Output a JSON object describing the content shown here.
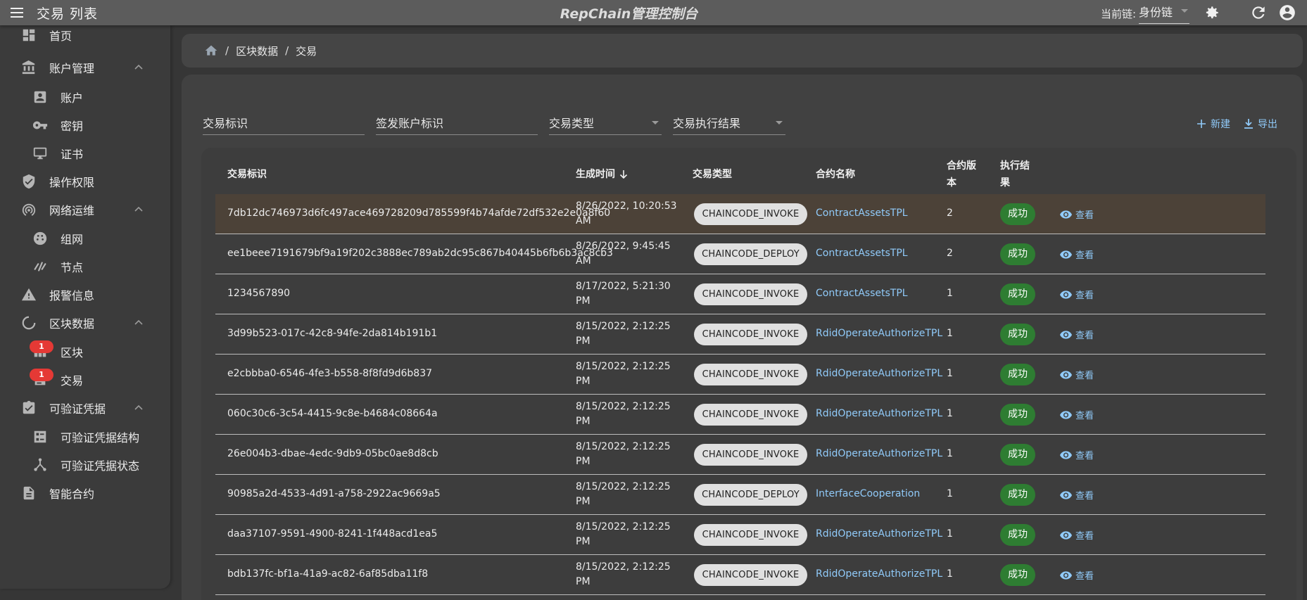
{
  "appbar": {
    "page_title": "交易 列表",
    "brand": "RepChain管理控制台",
    "chain_label": "当前链:",
    "chain_value": "身份链"
  },
  "sidebar": {
    "items": [
      {
        "label": "首页",
        "icon": "dashboard-icon"
      },
      {
        "label": "账户管理",
        "icon": "bank-icon",
        "expanded": true
      },
      {
        "label": "账户",
        "icon": "account-box-icon"
      },
      {
        "label": "密钥",
        "icon": "key-icon"
      },
      {
        "label": "证书",
        "icon": "certificate-icon"
      },
      {
        "label": "操作权限",
        "icon": "shield-icon"
      },
      {
        "label": "网络运维",
        "icon": "access-point-icon",
        "expanded": true
      },
      {
        "label": "组网",
        "icon": "network-icon"
      },
      {
        "label": "节点",
        "icon": "node-icon"
      },
      {
        "label": "报警信息",
        "icon": "alert-icon"
      },
      {
        "label": "区块数据",
        "icon": "block-data-icon",
        "expanded": true
      },
      {
        "label": "区块",
        "icon": "blocks-icon",
        "badge": "1"
      },
      {
        "label": "交易",
        "icon": "transaction-icon",
        "badge": "1"
      },
      {
        "label": "可验证凭据",
        "icon": "clipboard-check-icon",
        "expanded": true
      },
      {
        "label": "可验证凭据结构",
        "icon": "credential-schema-icon"
      },
      {
        "label": "可验证凭据状态",
        "icon": "credential-status-icon"
      },
      {
        "label": "智能合约",
        "icon": "contract-file-icon"
      }
    ]
  },
  "breadcrumb": {
    "items": [
      "区块数据",
      "交易"
    ],
    "separator": "/"
  },
  "filters": {
    "tx_id": "交易标识",
    "signer_id": "签发账户标识",
    "tx_type": "交易类型",
    "tx_result": "交易执行结果"
  },
  "actions": {
    "new": "新建",
    "export": "导出"
  },
  "table": {
    "headers": {
      "tx_id": "交易标识",
      "time": "生成时间",
      "type": "交易类型",
      "contract": "合约名称",
      "version_1": "合约版",
      "version_2": "本",
      "result_1": "执行结",
      "result_2": "果"
    },
    "view_label": "查看",
    "rows": [
      {
        "id": "7db12dc746973d6fc497ace469728209d785599f4b74afde72df532e2e0a8f60",
        "time1": "8/26/2022, 10:20:53",
        "time2": "AM",
        "type": "CHAINCODE_INVOKE",
        "contract": "ContractAssetsTPL",
        "version": "2",
        "result": "成功"
      },
      {
        "id": "ee1beee7191679bf9a19f202c3888ec789ab2dc95c867b40445b6fb6b3ac8cb3",
        "time1": "8/26/2022, 9:45:45",
        "time2": "AM",
        "type": "CHAINCODE_DEPLOY",
        "contract": "ContractAssetsTPL",
        "version": "2",
        "result": "成功"
      },
      {
        "id": "1234567890",
        "time1": "8/17/2022, 5:21:30",
        "time2": "PM",
        "type": "CHAINCODE_INVOKE",
        "contract": "ContractAssetsTPL",
        "version": "1",
        "result": "成功"
      },
      {
        "id": "3d99b523-017c-42c8-94fe-2da814b191b1",
        "time1": "8/15/2022, 2:12:25",
        "time2": "PM",
        "type": "CHAINCODE_INVOKE",
        "contract": "RdidOperateAuthorizeTPL",
        "version": "1",
        "result": "成功"
      },
      {
        "id": "e2cbbba0-6546-4fe3-b558-8f8fd9d6b837",
        "time1": "8/15/2022, 2:12:25",
        "time2": "PM",
        "type": "CHAINCODE_INVOKE",
        "contract": "RdidOperateAuthorizeTPL",
        "version": "1",
        "result": "成功"
      },
      {
        "id": "060c30c6-3c54-4415-9c8e-b4684c08664a",
        "time1": "8/15/2022, 2:12:25",
        "time2": "PM",
        "type": "CHAINCODE_INVOKE",
        "contract": "RdidOperateAuthorizeTPL",
        "version": "1",
        "result": "成功"
      },
      {
        "id": "26e004b3-dbae-4edc-9db9-05bc0ae8d8cb",
        "time1": "8/15/2022, 2:12:25",
        "time2": "PM",
        "type": "CHAINCODE_INVOKE",
        "contract": "RdidOperateAuthorizeTPL",
        "version": "1",
        "result": "成功"
      },
      {
        "id": "90985a2d-4533-4d91-a758-2922ac9669a5",
        "time1": "8/15/2022, 2:12:25",
        "time2": "PM",
        "type": "CHAINCODE_DEPLOY",
        "contract": "InterfaceCooperation",
        "version": "1",
        "result": "成功"
      },
      {
        "id": "daa37107-9591-4900-8241-1f448acd1ea5",
        "time1": "8/15/2022, 2:12:25",
        "time2": "PM",
        "type": "CHAINCODE_INVOKE",
        "contract": "RdidOperateAuthorizeTPL",
        "version": "1",
        "result": "成功"
      },
      {
        "id": "bdb137fc-bf1a-41a9-ac82-6af85dba11f8",
        "time1": "8/15/2022, 2:12:25",
        "time2": "PM",
        "type": "CHAINCODE_INVOKE",
        "contract": "RdidOperateAuthorizeTPL",
        "version": "1",
        "result": "成功"
      }
    ]
  },
  "colors": {
    "appbar": "#5c5c5c",
    "link": "#90caf9",
    "success": "#2e7d32",
    "badge": "#e53935",
    "highlight_row": "#4c4238"
  }
}
